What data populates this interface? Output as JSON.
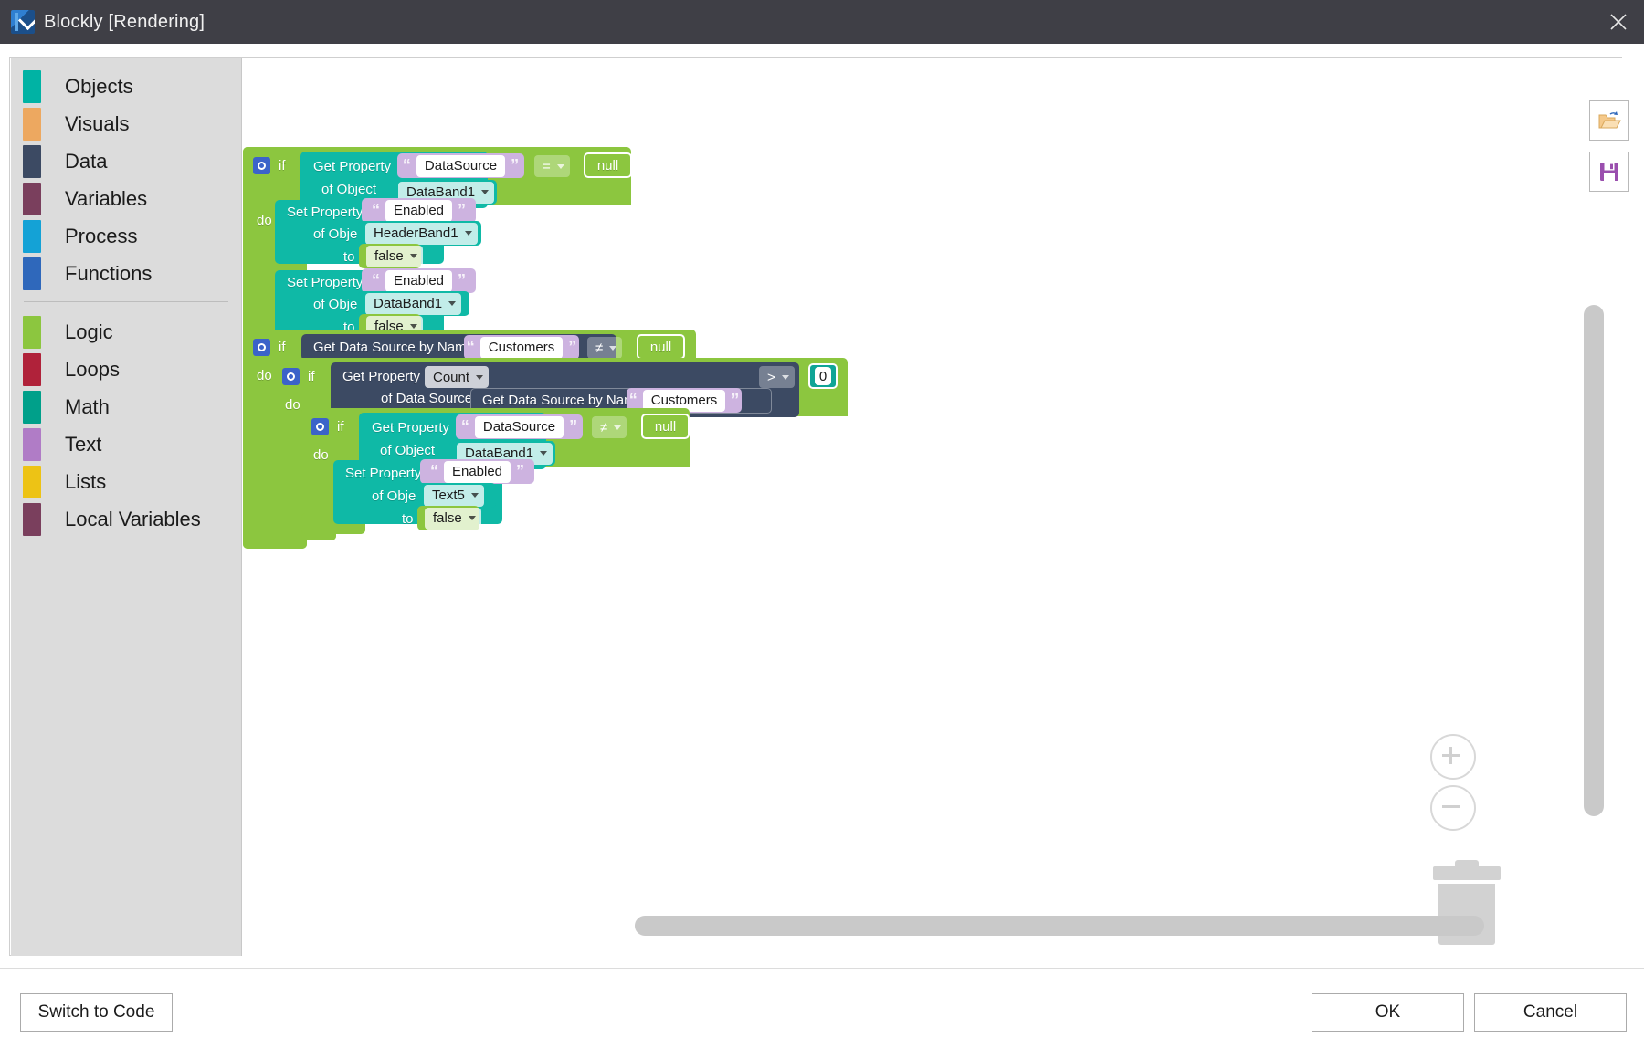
{
  "window": {
    "title": "Blockly [Rendering]",
    "logo_icon": "blockly-logo-icon",
    "close_icon": "close-icon"
  },
  "toolbox": {
    "groups": [
      {
        "items": [
          {
            "label": "Objects",
            "color": "#00b3a4"
          },
          {
            "label": "Visuals",
            "color": "#eda860"
          },
          {
            "label": "Data",
            "color": "#3c4a63"
          },
          {
            "label": "Variables",
            "color": "#7a3f5d"
          },
          {
            "label": "Process",
            "color": "#14a2d6"
          },
          {
            "label": "Functions",
            "color": "#2f68bb"
          }
        ]
      },
      {
        "items": [
          {
            "label": "Logic",
            "color": "#8cc63f"
          },
          {
            "label": "Loops",
            "color": "#b0223a"
          },
          {
            "label": "Math",
            "color": "#00a08a"
          },
          {
            "label": "Text",
            "color": "#b07cc6"
          },
          {
            "label": "Lists",
            "color": "#edc315"
          },
          {
            "label": "Local Variables",
            "color": "#7a3f5d"
          }
        ]
      }
    ]
  },
  "file_actions": {
    "open_icon": "open-folder-icon",
    "save_icon": "save-floppy-icon"
  },
  "workspace_controls": {
    "zoom_in_icon": "zoom-in-icon",
    "zoom_out_icon": "zoom-out-icon",
    "trash_icon": "trash-icon"
  },
  "blocks": {
    "if_label": "if",
    "do_label": "do",
    "get_property": "Get Property",
    "set_property": "Set Property",
    "of_object": "of Object",
    "of_data_source": "of Data Source",
    "to_label": "to",
    "get_data_source_by_name": "Get Data Source by Name",
    "group1": {
      "cond_property": "DataSource",
      "cond_object": "DataBand1",
      "operator": "=",
      "operand": "null",
      "statements": [
        {
          "property": "Enabled",
          "object": "HeaderBand1",
          "value": "false"
        },
        {
          "property": "Enabled",
          "object": "DataBand1",
          "value": "false"
        }
      ]
    },
    "group2": {
      "cond_datasource_name": "Customers",
      "operator": "≠",
      "operand": "null",
      "inner1": {
        "count_field": "Count",
        "datasource_name": "Customers",
        "operator": ">",
        "operand": "0",
        "inner2": {
          "cond_property": "DataSource",
          "cond_object": "DataBand1",
          "operator": "≠",
          "operand": "null",
          "statement": {
            "property": "Enabled",
            "object": "Text5",
            "value": "false"
          }
        }
      }
    }
  },
  "footer": {
    "switch_label": "Switch to Code",
    "ok_label": "OK",
    "cancel_label": "Cancel"
  }
}
